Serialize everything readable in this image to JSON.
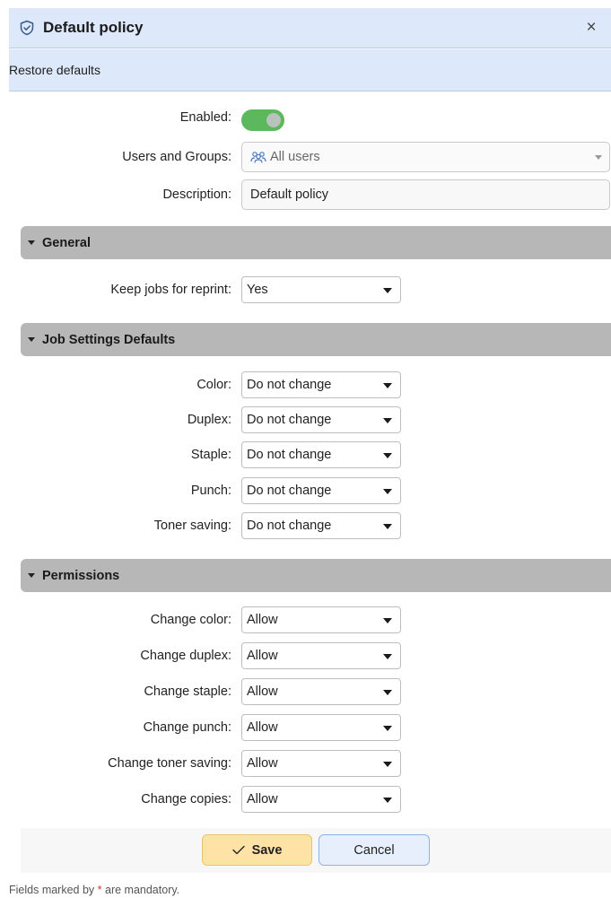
{
  "dialog": {
    "title": "Default policy",
    "close_glyph": "×",
    "icon": "shield-check-icon"
  },
  "toolbar": {
    "restore_label": "Restore defaults"
  },
  "fields": {
    "enabled_label": "Enabled:",
    "enabled_value": true,
    "users_label": "Users and Groups:",
    "users_value": "All users",
    "description_label": "Description:",
    "description_value": "Default policy"
  },
  "general": {
    "title": "General",
    "keep_jobs_label": "Keep jobs for reprint:",
    "keep_jobs_value": "Yes"
  },
  "job_settings": {
    "title": "Job Settings Defaults",
    "rows": [
      {
        "label": "Color:",
        "value": "Do not change"
      },
      {
        "label": "Duplex:",
        "value": "Do not change"
      },
      {
        "label": "Staple:",
        "value": "Do not change"
      },
      {
        "label": "Punch:",
        "value": "Do not change"
      },
      {
        "label": "Toner saving:",
        "value": "Do not change"
      }
    ]
  },
  "permissions": {
    "title": "Permissions",
    "rows": [
      {
        "label": "Change color:",
        "value": "Allow"
      },
      {
        "label": "Change duplex:",
        "value": "Allow"
      },
      {
        "label": "Change staple:",
        "value": "Allow"
      },
      {
        "label": "Change punch:",
        "value": "Allow"
      },
      {
        "label": "Change toner saving:",
        "value": "Allow"
      },
      {
        "label": "Change copies:",
        "value": "Allow"
      }
    ]
  },
  "actions": {
    "save_label": "Save",
    "cancel_label": "Cancel"
  },
  "footer": {
    "prefix": "Fields marked by ",
    "star": "*",
    "suffix": " are mandatory."
  },
  "colors": {
    "header_bg": "#dde9fb",
    "toggle_on": "#5cb85c",
    "section_bg": "#b7b7b7",
    "save_bg": "#ffe3a6",
    "cancel_bg": "#e6effb",
    "required_star": "#d9342b"
  }
}
